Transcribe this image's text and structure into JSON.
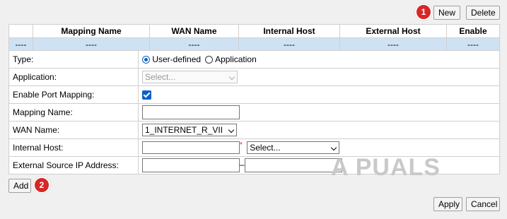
{
  "toolbar": {
    "new_label": "New",
    "delete_label": "Delete"
  },
  "annotations": {
    "badge1": "1",
    "badge2": "2"
  },
  "table": {
    "headers": [
      "",
      "Mapping Name",
      "WAN Name",
      "Internal Host",
      "External Host",
      "Enable"
    ],
    "empty_row": [
      "----",
      "----",
      "----",
      "----",
      "----",
      "----"
    ]
  },
  "form": {
    "type": {
      "label": "Type:",
      "option1": "User-defined",
      "option2": "Application",
      "selected": "User-defined"
    },
    "application": {
      "label": "Application:",
      "value": "Select..."
    },
    "enable_port_mapping": {
      "label": "Enable Port Mapping:",
      "checked": true
    },
    "mapping_name": {
      "label": "Mapping Name:",
      "value": ""
    },
    "wan_name": {
      "label": "WAN Name:",
      "value": "1_INTERNET_R_VII"
    },
    "internal_host": {
      "label": "Internal Host:",
      "required_mark": "*",
      "select_value": "Select..."
    },
    "external_source_ip": {
      "label": "External Source IP Address:",
      "separator": "–"
    }
  },
  "actions": {
    "add_label": "Add",
    "apply_label": "Apply",
    "cancel_label": "Cancel"
  },
  "watermark": {
    "text": "A PUALS"
  },
  "colors": {
    "header_row_bg": "#cfe2f3",
    "badge": "#d62828",
    "accent": "#0b62c4"
  }
}
